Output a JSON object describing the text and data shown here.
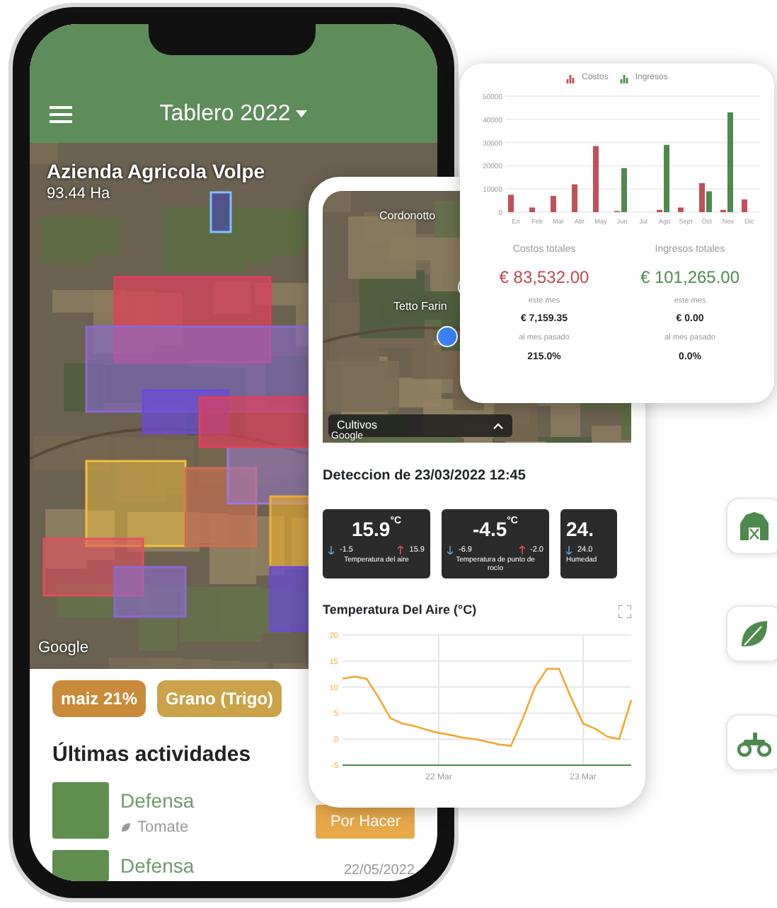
{
  "phone": {
    "header": {
      "title": "Tablero 2022"
    },
    "map": {
      "farm_name": "Azienda Agricola Volpe",
      "area": "93.44 Ha",
      "attribution": "Google"
    },
    "crop_chips": [
      {
        "label": "maiz 21%",
        "color": "#c98a3a"
      },
      {
        "label": "Grano (Trigo)",
        "color": "#c9a24a"
      }
    ],
    "activities": {
      "title": "Últimas actividades",
      "items": [
        {
          "title": "Defensa",
          "crop": "Tomate",
          "status": "Por Hacer"
        },
        {
          "title": "Defensa",
          "date": "22/05/2022"
        }
      ]
    }
  },
  "sensor": {
    "map": {
      "places": [
        "Cordonotto",
        "Tetto Farin"
      ],
      "panel": "Cultivos",
      "attribution": "Google"
    },
    "detection": "Deteccion de 23/03/2022 12:45",
    "tiles": [
      {
        "value": "15.9",
        "unit": "°C",
        "min": "-1.5",
        "max": "15.9",
        "label": "Temperatura del aire"
      },
      {
        "value": "-4.5",
        "unit": "°C",
        "min": "-6.9",
        "max": "-2.0",
        "label": "Temperatura de punto de rocío"
      },
      {
        "value": "24.",
        "min": "24.0",
        "label": "Humedad"
      }
    ],
    "chart": {
      "title": "Temperatura Del Aire (°C)",
      "chart_data": {
        "type": "line",
        "categories": [
          null,
          null,
          null,
          null,
          null,
          null,
          null,
          null,
          "22 Mar",
          null,
          null,
          null,
          null,
          null,
          null,
          null,
          null,
          null,
          null,
          null,
          "23 Mar",
          null,
          null,
          null,
          null
        ],
        "series": [
          {
            "color": "#f0a830",
            "values": [
              11.6,
              12,
              11.6,
              8,
              4,
              3,
              2.5,
              1.8,
              1.2,
              0.8,
              0.3,
              0,
              -0.5,
              -1,
              -1.3,
              4,
              10,
              13.5,
              13.5,
              8,
              3,
              2,
              0.5,
              0,
              7.5
            ]
          }
        ],
        "ylim": [
          -5,
          20
        ],
        "yticks": [
          -5,
          0,
          5,
          10,
          15,
          20
        ],
        "grid": true
      }
    }
  },
  "finance": {
    "chart_data": {
      "type": "bar",
      "categories": [
        "En",
        "Feb",
        "Mar",
        "Abr",
        "May",
        "Jun",
        "Jul",
        "Ago",
        "Sept",
        "Oct",
        "Nov",
        "Dic"
      ],
      "series": [
        {
          "name": "Costos",
          "color": "#c0505a",
          "values": [
            7500,
            2000,
            7000,
            12000,
            28500,
            500,
            0,
            1000,
            2000,
            12500,
            1000,
            5500
          ]
        },
        {
          "name": "Ingresos",
          "color": "#4e8a4e",
          "values": [
            0,
            0,
            0,
            0,
            0,
            19000,
            0,
            29000,
            0,
            9000,
            43000,
            0
          ]
        }
      ],
      "ylim": [
        0,
        50000
      ],
      "yticks": [
        0,
        10000,
        20000,
        30000,
        40000,
        50000
      ],
      "grid": true
    },
    "totals": [
      {
        "label": "Costos totales",
        "amount": "€ 83,532.00",
        "color": "#c0474f",
        "period_label": "este mes",
        "period_value": "€ 7,159.35",
        "change_label": "al mes pasado",
        "change_value": "215.0%"
      },
      {
        "label": "Ingresos totales",
        "amount": "€ 101,265.00",
        "color": "#4e8a4e",
        "period_label": "este mes",
        "period_value": "€ 0.00",
        "change_label": "al mes pasado",
        "change_value": "0.0%"
      }
    ]
  },
  "feature_icons": [
    {
      "kind": "barn"
    },
    {
      "kind": "leaf"
    },
    {
      "kind": "atv"
    }
  ]
}
